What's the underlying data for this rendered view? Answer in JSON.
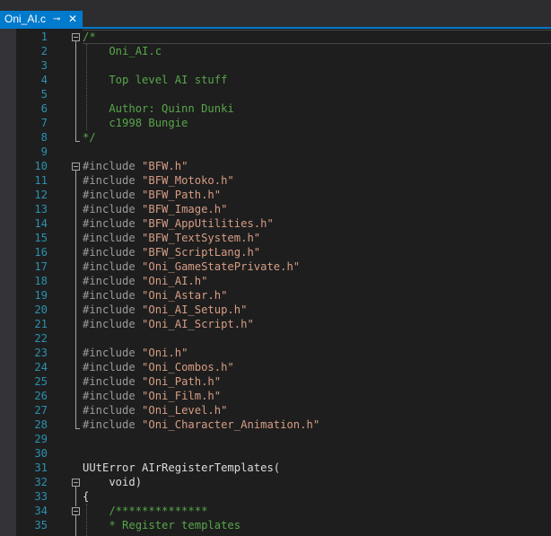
{
  "tab": {
    "title": "Oni_AI.c",
    "pin_glyph": "⊸",
    "close_glyph": "✕"
  },
  "colors": {
    "accent": "#007acc",
    "background": "#1e1e1e",
    "comment": "#57a64a",
    "preprocessor": "#9b9b9b",
    "string": "#d69d85",
    "line_number": "#2b91af"
  },
  "lines": [
    {
      "n": "1",
      "tokens": [
        {
          "t": "/*",
          "c": "comment"
        }
      ]
    },
    {
      "n": "2",
      "tokens": [
        {
          "t": "    Oni_AI.c",
          "c": "comment"
        }
      ]
    },
    {
      "n": "3",
      "tokens": []
    },
    {
      "n": "4",
      "tokens": [
        {
          "t": "    Top level AI stuff",
          "c": "comment"
        }
      ]
    },
    {
      "n": "5",
      "tokens": []
    },
    {
      "n": "6",
      "tokens": [
        {
          "t": "    Author: Quinn Dunki",
          "c": "comment"
        }
      ]
    },
    {
      "n": "7",
      "tokens": [
        {
          "t": "    c1998 Bungie",
          "c": "comment"
        }
      ]
    },
    {
      "n": "8",
      "tokens": [
        {
          "t": "*/",
          "c": "comment"
        }
      ]
    },
    {
      "n": "9",
      "tokens": []
    },
    {
      "n": "10",
      "tokens": [
        {
          "t": "#include ",
          "c": "pre"
        },
        {
          "t": "\"BFW.h\"",
          "c": "str"
        }
      ]
    },
    {
      "n": "11",
      "tokens": [
        {
          "t": "#include ",
          "c": "pre"
        },
        {
          "t": "\"BFW_Motoko.h\"",
          "c": "str"
        }
      ]
    },
    {
      "n": "12",
      "tokens": [
        {
          "t": "#include ",
          "c": "pre"
        },
        {
          "t": "\"BFW_Path.h\"",
          "c": "str"
        }
      ]
    },
    {
      "n": "13",
      "tokens": [
        {
          "t": "#include ",
          "c": "pre"
        },
        {
          "t": "\"BFW_Image.h\"",
          "c": "str"
        }
      ]
    },
    {
      "n": "14",
      "tokens": [
        {
          "t": "#include ",
          "c": "pre"
        },
        {
          "t": "\"BFW_AppUtilities.h\"",
          "c": "str"
        }
      ]
    },
    {
      "n": "15",
      "tokens": [
        {
          "t": "#include ",
          "c": "pre"
        },
        {
          "t": "\"BFW_TextSystem.h\"",
          "c": "str"
        }
      ]
    },
    {
      "n": "16",
      "tokens": [
        {
          "t": "#include ",
          "c": "pre"
        },
        {
          "t": "\"BFW_ScriptLang.h\"",
          "c": "str"
        }
      ]
    },
    {
      "n": "17",
      "tokens": [
        {
          "t": "#include ",
          "c": "pre"
        },
        {
          "t": "\"Oni_GameStatePrivate.h\"",
          "c": "str"
        }
      ]
    },
    {
      "n": "18",
      "tokens": [
        {
          "t": "#include ",
          "c": "pre"
        },
        {
          "t": "\"Oni_AI.h\"",
          "c": "str"
        }
      ]
    },
    {
      "n": "19",
      "tokens": [
        {
          "t": "#include ",
          "c": "pre"
        },
        {
          "t": "\"Oni_Astar.h\"",
          "c": "str"
        }
      ]
    },
    {
      "n": "20",
      "tokens": [
        {
          "t": "#include ",
          "c": "pre"
        },
        {
          "t": "\"Oni_AI_Setup.h\"",
          "c": "str"
        }
      ]
    },
    {
      "n": "21",
      "tokens": [
        {
          "t": "#include ",
          "c": "pre"
        },
        {
          "t": "\"Oni_AI_Script.h\"",
          "c": "str"
        }
      ]
    },
    {
      "n": "22",
      "tokens": []
    },
    {
      "n": "23",
      "tokens": [
        {
          "t": "#include ",
          "c": "pre"
        },
        {
          "t": "\"Oni.h\"",
          "c": "str"
        }
      ]
    },
    {
      "n": "24",
      "tokens": [
        {
          "t": "#include ",
          "c": "pre"
        },
        {
          "t": "\"Oni_Combos.h\"",
          "c": "str"
        }
      ]
    },
    {
      "n": "25",
      "tokens": [
        {
          "t": "#include ",
          "c": "pre"
        },
        {
          "t": "\"Oni_Path.h\"",
          "c": "str"
        }
      ]
    },
    {
      "n": "26",
      "tokens": [
        {
          "t": "#include ",
          "c": "pre"
        },
        {
          "t": "\"Oni_Film.h\"",
          "c": "str"
        }
      ]
    },
    {
      "n": "27",
      "tokens": [
        {
          "t": "#include ",
          "c": "pre"
        },
        {
          "t": "\"Oni_Level.h\"",
          "c": "str"
        }
      ]
    },
    {
      "n": "28",
      "tokens": [
        {
          "t": "#include ",
          "c": "pre"
        },
        {
          "t": "\"Oni_Character_Animation.h\"",
          "c": "str"
        }
      ]
    },
    {
      "n": "29",
      "tokens": []
    },
    {
      "n": "30",
      "tokens": []
    },
    {
      "n": "31",
      "tokens": [
        {
          "t": "UUtError AIrRegisterTemplates(",
          "c": "kw"
        }
      ]
    },
    {
      "n": "32",
      "tokens": [
        {
          "t": "    void)",
          "c": "kw"
        }
      ]
    },
    {
      "n": "33",
      "tokens": [
        {
          "t": "{",
          "c": "kw"
        }
      ]
    },
    {
      "n": "34",
      "tokens": [
        {
          "t": "    /**************",
          "c": "comment"
        }
      ]
    },
    {
      "n": "35",
      "tokens": [
        {
          "t": "    * Register templates",
          "c": "comment"
        }
      ]
    }
  ]
}
